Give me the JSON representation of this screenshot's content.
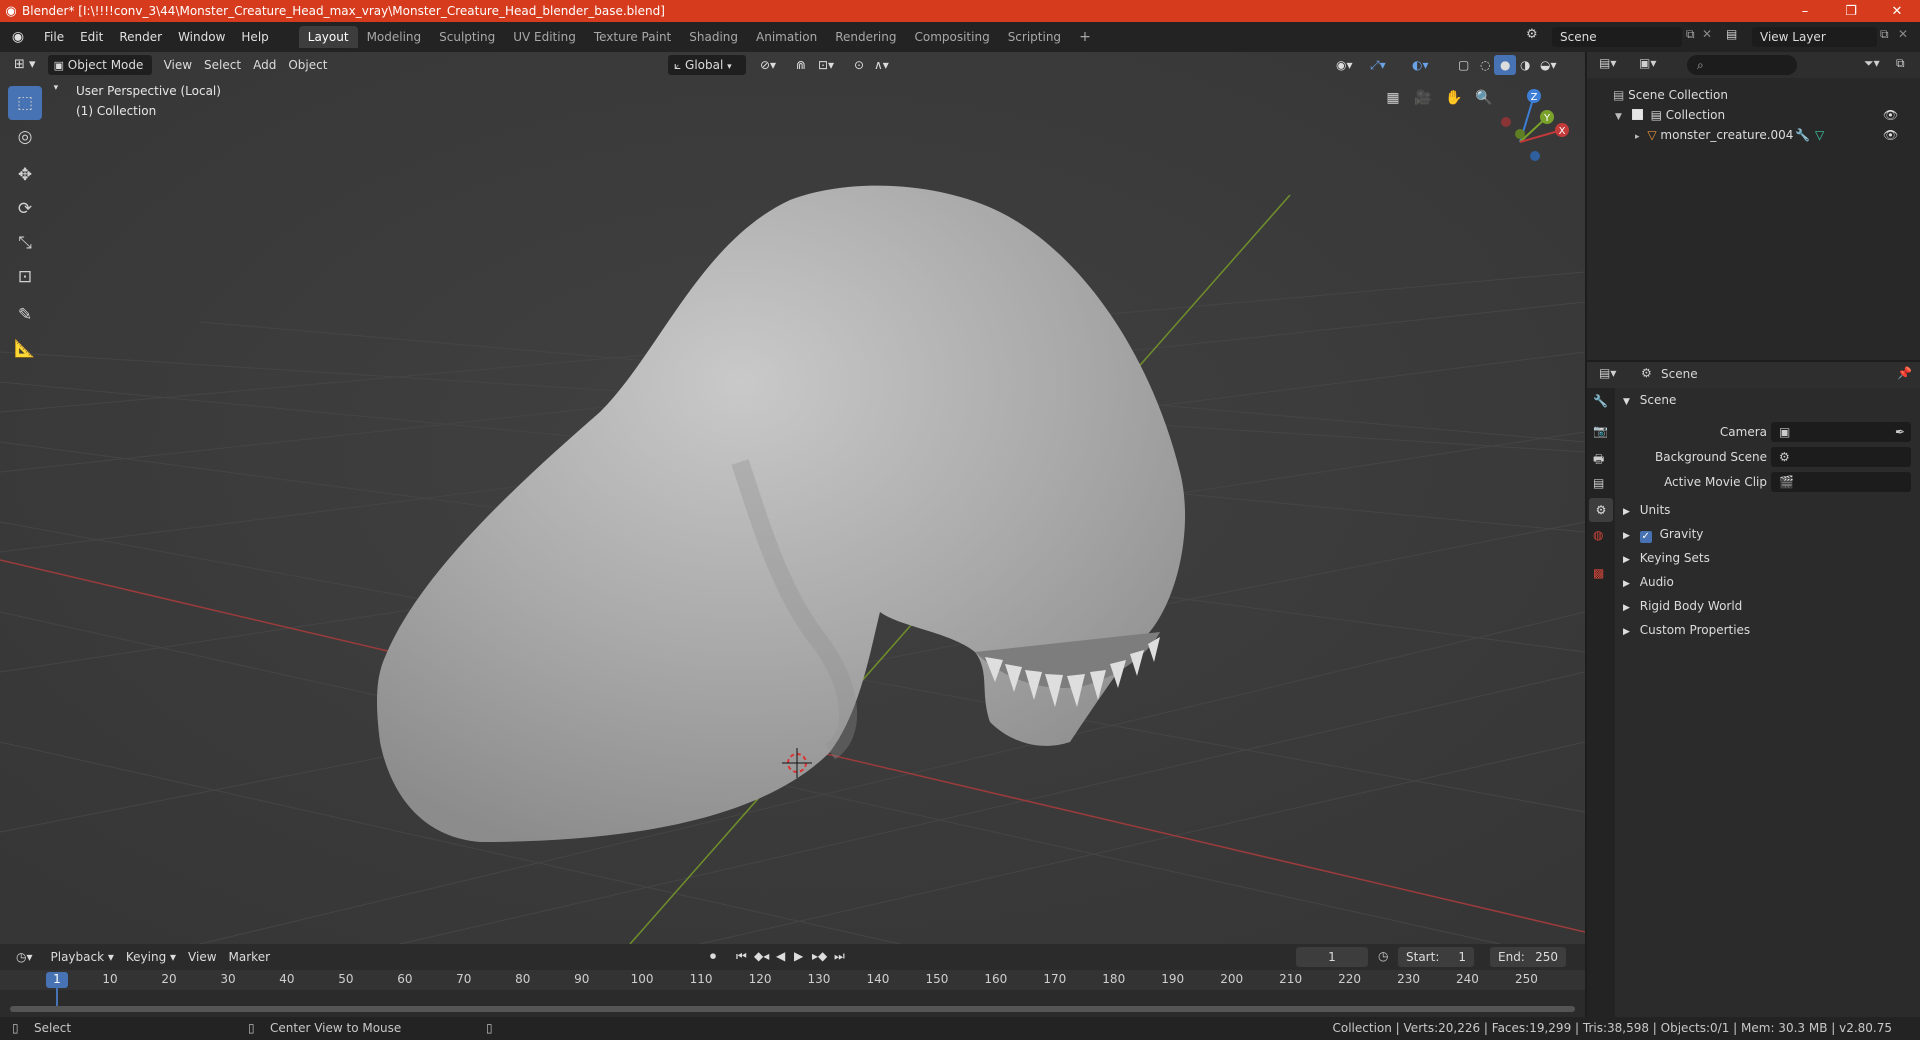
{
  "window": {
    "title": "Blender* [I:\\!!!!conv_3\\44\\Monster_Creature_Head_max_vray\\Monster_Creature_Head_blender_base.blend]",
    "min": "–",
    "max": "❐",
    "close": "✕"
  },
  "menu": [
    "File",
    "Edit",
    "Render",
    "Window",
    "Help"
  ],
  "workspaces": [
    "Layout",
    "Modeling",
    "Sculpting",
    "UV Editing",
    "Texture Paint",
    "Shading",
    "Animation",
    "Rendering",
    "Compositing",
    "Scripting",
    "+"
  ],
  "scene_field": "Scene",
  "view_layer_field": "View Layer",
  "viewport": {
    "mode": "Object Mode",
    "menus": [
      "View",
      "Select",
      "Add",
      "Object"
    ],
    "orientation": "Global",
    "overlay_line1": "User Perspective (Local)",
    "overlay_line2": "(1) Collection",
    "gizmo": {
      "z": "Z",
      "y": "Y",
      "x": "X"
    }
  },
  "outliner": {
    "root": "Scene Collection",
    "collection": "Collection",
    "object": "monster_creature.004"
  },
  "properties": {
    "header": "Scene",
    "panel": "Scene",
    "camera_label": "Camera",
    "bg_scene_label": "Background Scene",
    "movie_clip_label": "Active Movie Clip",
    "sections": [
      "Units",
      "Gravity",
      "Keying Sets",
      "Audio",
      "Rigid Body World",
      "Custom Properties"
    ]
  },
  "timeline": {
    "menus": [
      "Playback",
      "Keying",
      "View",
      "Marker"
    ],
    "current_frame": "1",
    "start_label": "Start:",
    "start": "1",
    "end_label": "End:",
    "end": "250",
    "ticks": [
      "1",
      "10",
      "20",
      "30",
      "40",
      "50",
      "60",
      "70",
      "80",
      "90",
      "100",
      "110",
      "120",
      "130",
      "140",
      "150",
      "160",
      "170",
      "180",
      "190",
      "200",
      "210",
      "220",
      "230",
      "240",
      "250"
    ]
  },
  "status": {
    "select": "Select",
    "center": "Center View to Mouse",
    "stats": "Collection | Verts:20,226 | Faces:19,299 | Tris:38,598 | Objects:0/1 | Mem: 30.3 MB | v2.80.75"
  },
  "colors": {
    "accent": "#4772b3",
    "title_bar": "#d63b1d",
    "x_axis": "#c33a3a",
    "y_axis": "#7aa22a",
    "z_axis": "#3d7fd6"
  }
}
